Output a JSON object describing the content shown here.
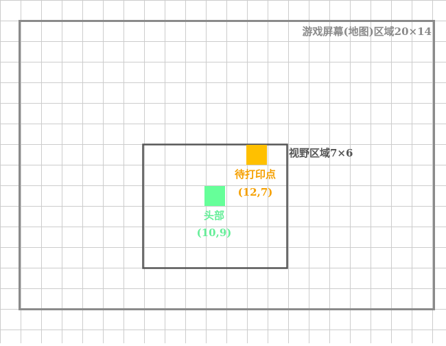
{
  "map": {
    "label": "游戏屏幕(地图)区域20×14",
    "frame_color": "#8a8a8a"
  },
  "viewport": {
    "label": "视野区域7×6",
    "frame_color": "#555555"
  },
  "grid": {
    "line_color": "#cccccc"
  },
  "cells": {
    "print_target": {
      "name": "待打印点",
      "coord": "(12,7)",
      "color": "#ffc000",
      "text_color": "#f5a000"
    },
    "head": {
      "name": "头部",
      "coord": "(10,9)",
      "color": "#66ff99",
      "text_color": "#66ee99"
    }
  }
}
